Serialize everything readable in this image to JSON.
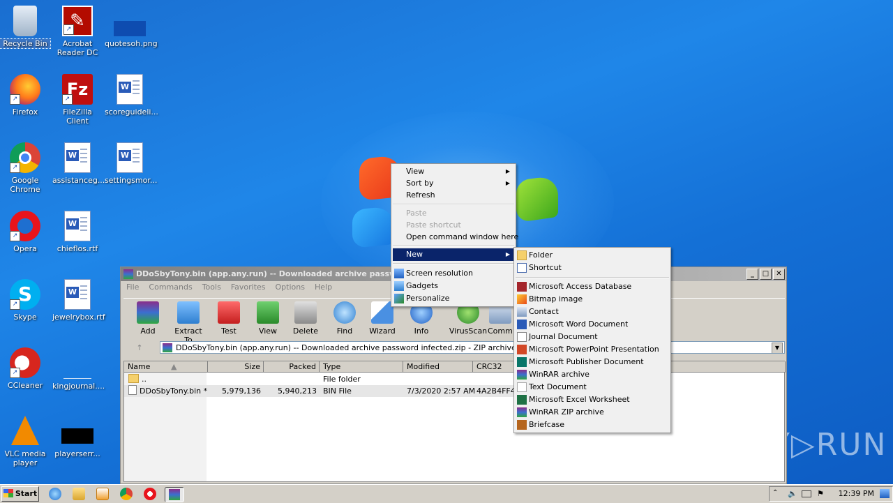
{
  "desktop": {
    "icons": [
      {
        "label": "Recycle Bin"
      },
      {
        "label": "Acrobat Reader DC"
      },
      {
        "label": "quotesoh.png"
      },
      {
        "label": "Firefox"
      },
      {
        "label": "FileZilla Client"
      },
      {
        "label": "scoreguideli..."
      },
      {
        "label": "Google Chrome"
      },
      {
        "label": "assistanceg..."
      },
      {
        "label": "settingsmor..."
      },
      {
        "label": "Opera"
      },
      {
        "label": "chieflos.rtf"
      },
      {
        "label": "Skype"
      },
      {
        "label": "jewelrybox.rtf"
      },
      {
        "label": "CCleaner"
      },
      {
        "label": "kingjournal...."
      },
      {
        "label": "VLC media player"
      },
      {
        "label": "playerserr..."
      }
    ],
    "watermark": "ANY▷RUN"
  },
  "winrar": {
    "title": "DDoSbyTony.bin (app.any.run) -- Downloaded archive password i",
    "menu": [
      "File",
      "Commands",
      "Tools",
      "Favorites",
      "Options",
      "Help"
    ],
    "toolbar": [
      "Add",
      "Extract To",
      "Test",
      "View",
      "Delete",
      "Find",
      "Wizard",
      "Info",
      "VirusScan",
      "Comme"
    ],
    "address": "DDoSbyTony.bin (app.any.run) -- Downloaded archive password infected.zip - ZIP archive, unpacked",
    "columns": [
      "Name",
      "Size",
      "Packed",
      "Type",
      "Modified",
      "CRC32"
    ],
    "rows": [
      {
        "name": "..",
        "size": "",
        "packed": "",
        "type": "File folder",
        "modified": "",
        "crc": ""
      },
      {
        "name": "DDoSbyTony.bin *",
        "size": "5,979,136",
        "packed": "5,940,213",
        "type": "BIN File",
        "modified": "7/3/2020 2:57 AM",
        "crc": "4A2B4FF4"
      }
    ]
  },
  "context_menu": {
    "items": [
      "View",
      "Sort by",
      "Refresh",
      "Paste",
      "Paste shortcut",
      "Open command window here",
      "New",
      "Screen resolution",
      "Gadgets",
      "Personalize"
    ]
  },
  "new_submenu": {
    "items": [
      "Folder",
      "Shortcut",
      "Microsoft Access Database",
      "Bitmap image",
      "Contact",
      "Microsoft Word Document",
      "Journal Document",
      "Microsoft PowerPoint Presentation",
      "Microsoft Publisher Document",
      "WinRAR archive",
      "Text Document",
      "Microsoft Excel Worksheet",
      "WinRAR ZIP archive",
      "Briefcase"
    ]
  },
  "taskbar": {
    "start_label": "Start",
    "clock": "12:39 PM"
  },
  "colors": {
    "highlight": "#0a246a",
    "desktop": "#1f86e8"
  }
}
